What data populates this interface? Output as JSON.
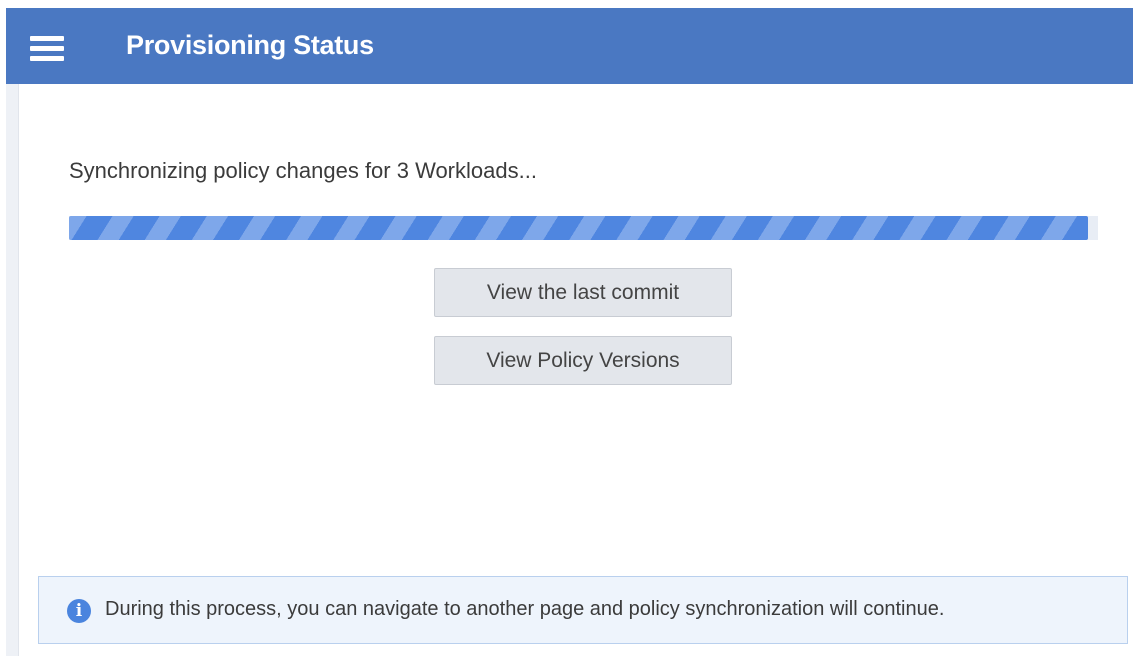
{
  "header": {
    "title": "Provisioning Status",
    "menu_icon": "hamburger-menu-icon",
    "background_color": "#4a78c2"
  },
  "main": {
    "status_text": "Synchronizing policy changes for 3 Workloads...",
    "progress": {
      "fraction": 0.99,
      "fill_color": "#4f86e0",
      "stripe_color": "#7ea7ea",
      "animated_stripes": true
    },
    "buttons": {
      "last_commit": "View the last commit",
      "policy_versions": "View Policy Versions"
    }
  },
  "info": {
    "icon": "info-icon",
    "icon_glyph": "i",
    "text": "During this process, you can navigate to another page and policy synchronization will continue.",
    "accent_color": "#4a84de"
  }
}
